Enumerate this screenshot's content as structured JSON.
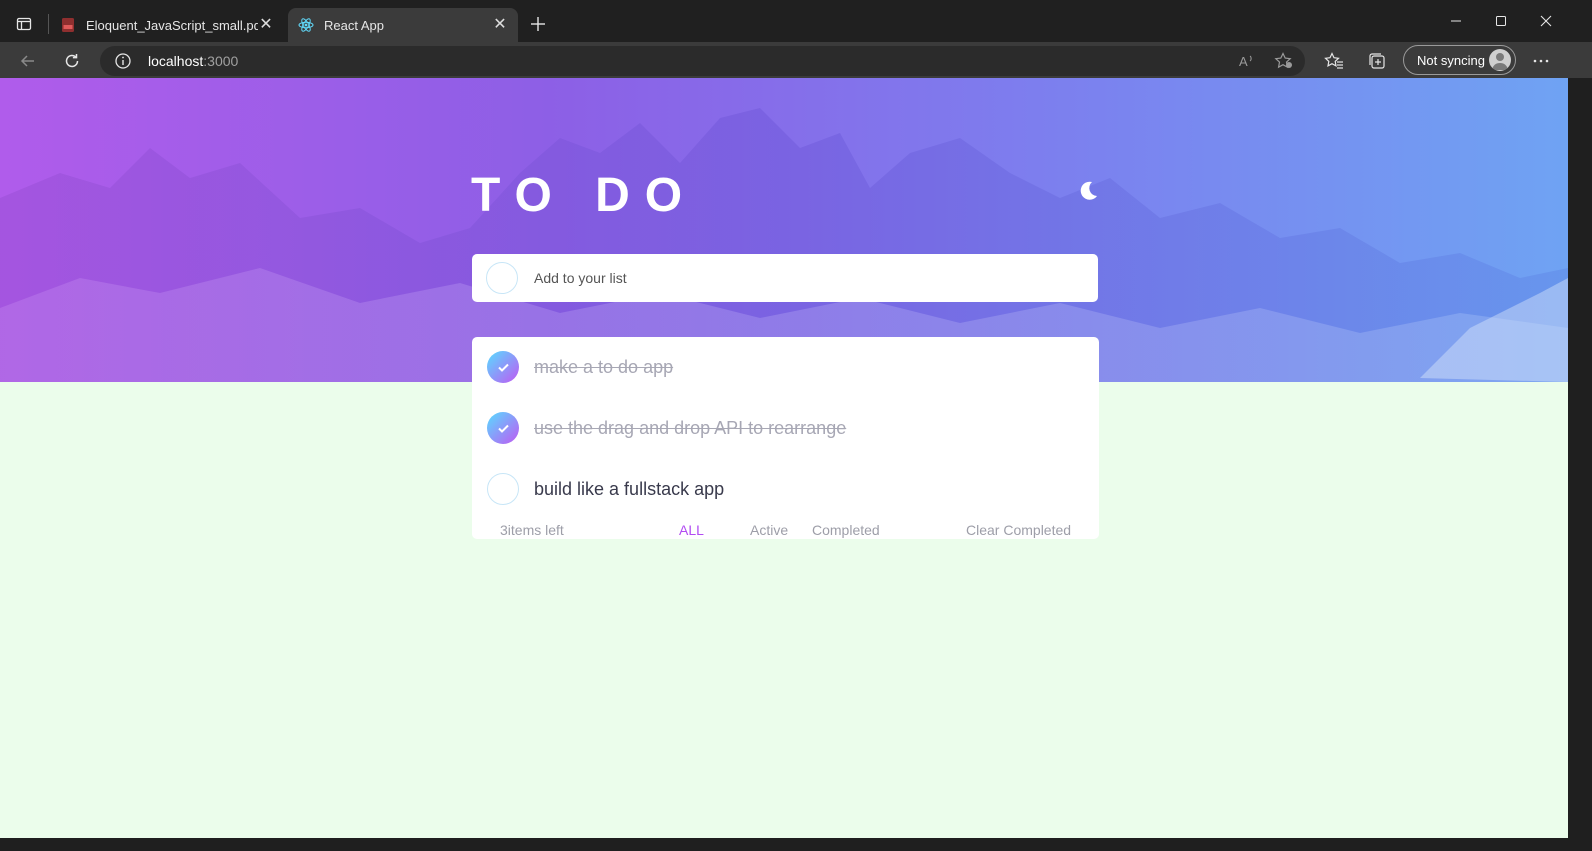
{
  "browser": {
    "tabs": [
      {
        "title": "Eloquent_JavaScript_small.pdf",
        "icon": "pdf-icon",
        "active": false
      },
      {
        "title": "React App",
        "icon": "react-icon",
        "active": true
      }
    ],
    "url_host": "localhost",
    "url_port": ":3000",
    "sync_label": "Not syncing"
  },
  "app": {
    "title": "TO DO",
    "theme_icon": "moon-icon",
    "new_todo_placeholder": "Add to your list",
    "todos": [
      {
        "text": "make a to do app",
        "completed": true
      },
      {
        "text": "use the drag and drop API to rearrange",
        "completed": true
      },
      {
        "text": "build like a fullstack app",
        "completed": false
      }
    ],
    "footer": {
      "items_left": "3items left",
      "filters": [
        "ALL",
        "Active",
        "Completed"
      ],
      "active_filter": "ALL",
      "clear_label": "Clear Completed"
    }
  },
  "colors": {
    "accent": "#b24cf2",
    "page_bg": "#ebfdeb",
    "check_gradient_start": "#57ddff",
    "check_gradient_end": "#c058f3"
  }
}
